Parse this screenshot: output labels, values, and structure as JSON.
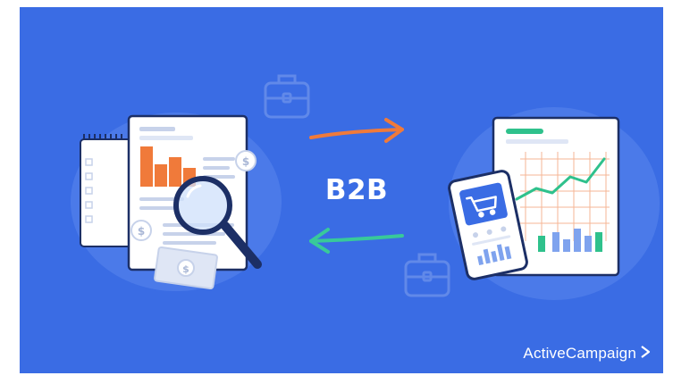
{
  "center_label": "B2B",
  "brand": {
    "name": "ActiveCampaign",
    "chevron_icon": "chevron-right-icon"
  },
  "colors": {
    "background": "#3a6ce4",
    "arrow_orange": "#f07a3a",
    "arrow_green": "#38c99a",
    "accent_orange": "#f07a3a",
    "accent_green": "#2fc18c",
    "accent_blue": "#3a6ce4",
    "dark_navy": "#1c2f66"
  },
  "icons": {
    "left_illustration": [
      "notepad-icon",
      "document-icon",
      "bar-chart-icon",
      "magnifier-icon",
      "dollar-bill-icon",
      "coin-icon"
    ],
    "right_illustration": [
      "report-icon",
      "line-chart-icon",
      "smartphone-icon",
      "shopping-cart-icon"
    ],
    "decor": [
      "briefcase-icon"
    ]
  }
}
